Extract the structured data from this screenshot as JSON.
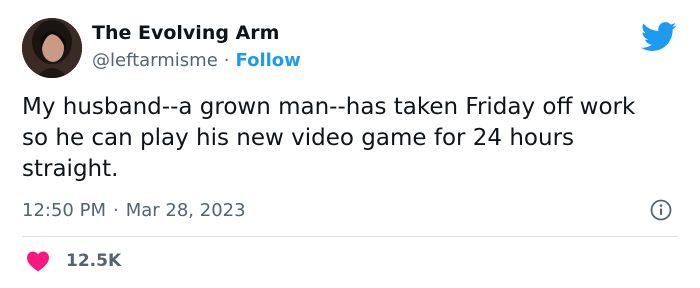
{
  "user": {
    "display_name": "The Evolving Arm",
    "handle": "@leftarmisme",
    "separator": "·",
    "follow_label": "Follow"
  },
  "tweet": {
    "text": "My husband--a grown man--has taken Friday off work so he can play his new video game for 24 hours straight.",
    "time": "12:50 PM",
    "separator": "·",
    "date": "Mar 28, 2023"
  },
  "engagement": {
    "likes": "12.5K"
  },
  "icons": {
    "brand": "twitter-bird-icon",
    "info": "info-icon",
    "like": "heart-icon"
  },
  "colors": {
    "brand_blue": "#1d9bf0",
    "like_red": "#f91880",
    "text_primary": "#0f1419",
    "text_secondary": "#536471"
  }
}
